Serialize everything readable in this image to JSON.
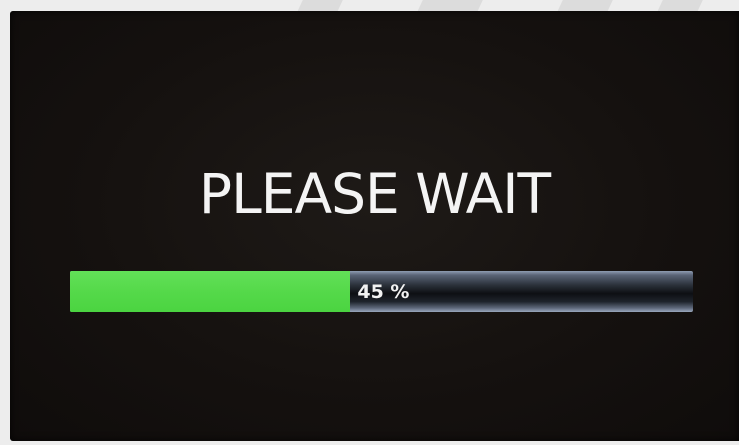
{
  "screen": {
    "title": "PLEASE WAIT"
  },
  "progress": {
    "fraction": 0.45,
    "label": "45 %",
    "fill_color": "#55d94a",
    "track_color": "#1a1f26"
  }
}
